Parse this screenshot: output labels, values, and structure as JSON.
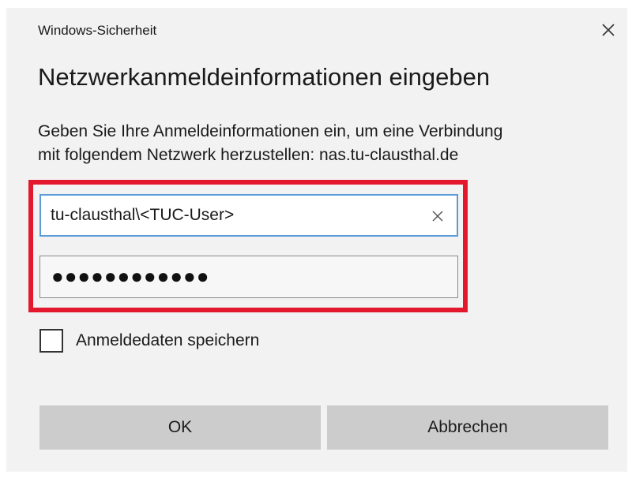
{
  "window": {
    "caption": "Windows-Sicherheit",
    "close_icon": "close-icon"
  },
  "dialog": {
    "heading": "Netzwerkanmeldeinformationen eingeben",
    "message_line1": "Geben Sie Ihre Anmeldeinformationen ein, um eine Verbindung",
    "message_line2": "mit folgendem Netzwerk herzustellen: nas.tu-clausthal.de"
  },
  "fields": {
    "username_value": "tu-clausthal\\<TUC-User>",
    "username_clear_icon": "clear-icon",
    "password_mask": "●●●●●●●●●●●●"
  },
  "remember": {
    "label": "Anmeldedaten speichern",
    "checked": false
  },
  "buttons": {
    "ok_label": "OK",
    "cancel_label": "Abbrechen"
  },
  "colors": {
    "dialog_background": "#f2f2f2",
    "highlight_frame": "#e3182d",
    "focus_border": "#5b9bd8",
    "button_background": "#cccccc"
  }
}
